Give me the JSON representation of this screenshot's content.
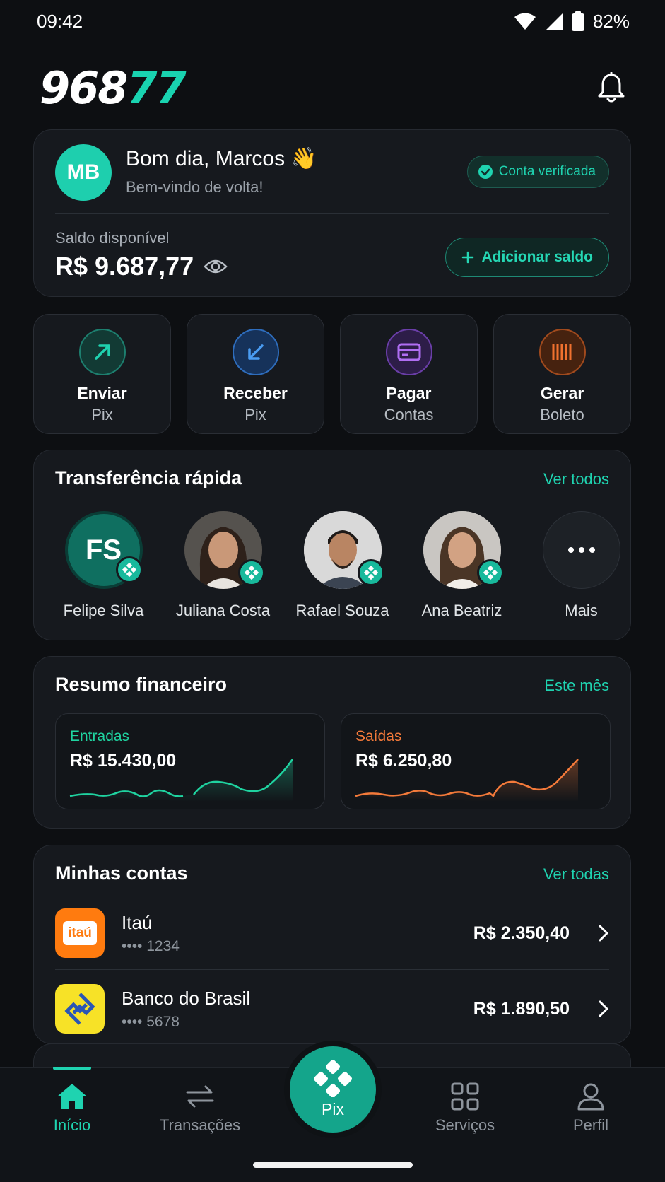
{
  "status_bar": {
    "time": "09:42",
    "battery": "82%"
  },
  "header": {
    "logo_white": "968",
    "logo_teal": "77"
  },
  "profile": {
    "initials": "MB",
    "greeting": "Bom dia, Marcos 👋",
    "welcome": "Bem-vindo de volta!",
    "verified_label": "Conta verificada",
    "balance_label": "Saldo disponível",
    "balance_value": "R$ 9.687,77",
    "add_balance_label": "Adicionar saldo"
  },
  "actions": [
    {
      "title": "Enviar",
      "subtitle": "Pix",
      "icon": "arrow-up-right-icon",
      "color": "#1fd3b0"
    },
    {
      "title": "Receber",
      "subtitle": "Pix",
      "icon": "arrow-down-left-icon",
      "color": "#3b8eea"
    },
    {
      "title": "Pagar",
      "subtitle": "Contas",
      "icon": "card-icon",
      "color": "#a461e8"
    },
    {
      "title": "Gerar",
      "subtitle": "Boleto",
      "icon": "barcode-icon",
      "color": "#f0712f"
    }
  ],
  "quick_transfer": {
    "title": "Transferência rápida",
    "link": "Ver todos",
    "contacts": [
      {
        "name": "Felipe Silva",
        "initials": "FS"
      },
      {
        "name": "Juliana Costa"
      },
      {
        "name": "Rafael Souza"
      },
      {
        "name": "Ana Beatriz"
      },
      {
        "name": "Mais"
      }
    ]
  },
  "summary": {
    "title": "Resumo financeiro",
    "link": "Este mês",
    "income_label": "Entradas",
    "income_value": "R$ 15.430,00",
    "income_color": "#1fd3a0",
    "expense_label": "Saídas",
    "expense_value": "R$ 6.250,80",
    "expense_color": "#f47a3a"
  },
  "accounts": {
    "title": "Minhas contas",
    "link": "Ver todas",
    "items": [
      {
        "name": "Itaú",
        "logo_text": "itaú",
        "number": "•••• 1234",
        "amount": "R$ 2.350,40"
      },
      {
        "name": "Banco do Brasil",
        "number": "•••• 5678",
        "amount": "R$ 1.890,50"
      }
    ]
  },
  "nav": {
    "home": "Início",
    "transactions": "Transações",
    "pix": "Pix",
    "services": "Serviços",
    "profile": "Perfil"
  }
}
